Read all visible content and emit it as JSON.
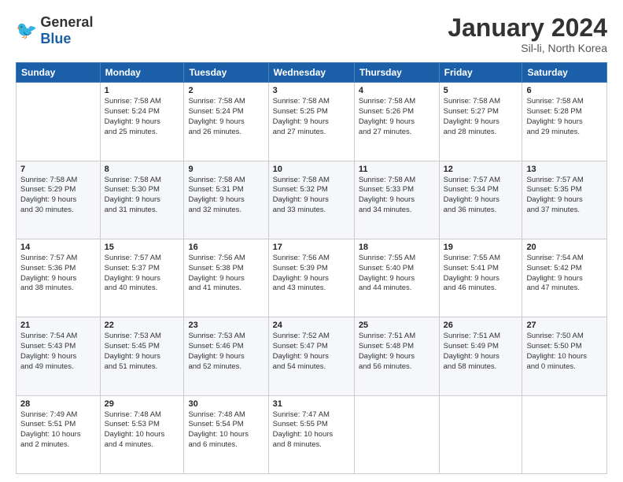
{
  "header": {
    "logo_general": "General",
    "logo_blue": "Blue",
    "month": "January 2024",
    "location": "Sil-li, North Korea"
  },
  "weekdays": [
    "Sunday",
    "Monday",
    "Tuesday",
    "Wednesday",
    "Thursday",
    "Friday",
    "Saturday"
  ],
  "weeks": [
    [
      {
        "day": "",
        "info": ""
      },
      {
        "day": "1",
        "info": "Sunrise: 7:58 AM\nSunset: 5:24 PM\nDaylight: 9 hours\nand 25 minutes."
      },
      {
        "day": "2",
        "info": "Sunrise: 7:58 AM\nSunset: 5:24 PM\nDaylight: 9 hours\nand 26 minutes."
      },
      {
        "day": "3",
        "info": "Sunrise: 7:58 AM\nSunset: 5:25 PM\nDaylight: 9 hours\nand 27 minutes."
      },
      {
        "day": "4",
        "info": "Sunrise: 7:58 AM\nSunset: 5:26 PM\nDaylight: 9 hours\nand 27 minutes."
      },
      {
        "day": "5",
        "info": "Sunrise: 7:58 AM\nSunset: 5:27 PM\nDaylight: 9 hours\nand 28 minutes."
      },
      {
        "day": "6",
        "info": "Sunrise: 7:58 AM\nSunset: 5:28 PM\nDaylight: 9 hours\nand 29 minutes."
      }
    ],
    [
      {
        "day": "7",
        "info": "Sunrise: 7:58 AM\nSunset: 5:29 PM\nDaylight: 9 hours\nand 30 minutes."
      },
      {
        "day": "8",
        "info": "Sunrise: 7:58 AM\nSunset: 5:30 PM\nDaylight: 9 hours\nand 31 minutes."
      },
      {
        "day": "9",
        "info": "Sunrise: 7:58 AM\nSunset: 5:31 PM\nDaylight: 9 hours\nand 32 minutes."
      },
      {
        "day": "10",
        "info": "Sunrise: 7:58 AM\nSunset: 5:32 PM\nDaylight: 9 hours\nand 33 minutes."
      },
      {
        "day": "11",
        "info": "Sunrise: 7:58 AM\nSunset: 5:33 PM\nDaylight: 9 hours\nand 34 minutes."
      },
      {
        "day": "12",
        "info": "Sunrise: 7:57 AM\nSunset: 5:34 PM\nDaylight: 9 hours\nand 36 minutes."
      },
      {
        "day": "13",
        "info": "Sunrise: 7:57 AM\nSunset: 5:35 PM\nDaylight: 9 hours\nand 37 minutes."
      }
    ],
    [
      {
        "day": "14",
        "info": "Sunrise: 7:57 AM\nSunset: 5:36 PM\nDaylight: 9 hours\nand 38 minutes."
      },
      {
        "day": "15",
        "info": "Sunrise: 7:57 AM\nSunset: 5:37 PM\nDaylight: 9 hours\nand 40 minutes."
      },
      {
        "day": "16",
        "info": "Sunrise: 7:56 AM\nSunset: 5:38 PM\nDaylight: 9 hours\nand 41 minutes."
      },
      {
        "day": "17",
        "info": "Sunrise: 7:56 AM\nSunset: 5:39 PM\nDaylight: 9 hours\nand 43 minutes."
      },
      {
        "day": "18",
        "info": "Sunrise: 7:55 AM\nSunset: 5:40 PM\nDaylight: 9 hours\nand 44 minutes."
      },
      {
        "day": "19",
        "info": "Sunrise: 7:55 AM\nSunset: 5:41 PM\nDaylight: 9 hours\nand 46 minutes."
      },
      {
        "day": "20",
        "info": "Sunrise: 7:54 AM\nSunset: 5:42 PM\nDaylight: 9 hours\nand 47 minutes."
      }
    ],
    [
      {
        "day": "21",
        "info": "Sunrise: 7:54 AM\nSunset: 5:43 PM\nDaylight: 9 hours\nand 49 minutes."
      },
      {
        "day": "22",
        "info": "Sunrise: 7:53 AM\nSunset: 5:45 PM\nDaylight: 9 hours\nand 51 minutes."
      },
      {
        "day": "23",
        "info": "Sunrise: 7:53 AM\nSunset: 5:46 PM\nDaylight: 9 hours\nand 52 minutes."
      },
      {
        "day": "24",
        "info": "Sunrise: 7:52 AM\nSunset: 5:47 PM\nDaylight: 9 hours\nand 54 minutes."
      },
      {
        "day": "25",
        "info": "Sunrise: 7:51 AM\nSunset: 5:48 PM\nDaylight: 9 hours\nand 56 minutes."
      },
      {
        "day": "26",
        "info": "Sunrise: 7:51 AM\nSunset: 5:49 PM\nDaylight: 9 hours\nand 58 minutes."
      },
      {
        "day": "27",
        "info": "Sunrise: 7:50 AM\nSunset: 5:50 PM\nDaylight: 10 hours\nand 0 minutes."
      }
    ],
    [
      {
        "day": "28",
        "info": "Sunrise: 7:49 AM\nSunset: 5:51 PM\nDaylight: 10 hours\nand 2 minutes."
      },
      {
        "day": "29",
        "info": "Sunrise: 7:48 AM\nSunset: 5:53 PM\nDaylight: 10 hours\nand 4 minutes."
      },
      {
        "day": "30",
        "info": "Sunrise: 7:48 AM\nSunset: 5:54 PM\nDaylight: 10 hours\nand 6 minutes."
      },
      {
        "day": "31",
        "info": "Sunrise: 7:47 AM\nSunset: 5:55 PM\nDaylight: 10 hours\nand 8 minutes."
      },
      {
        "day": "",
        "info": ""
      },
      {
        "day": "",
        "info": ""
      },
      {
        "day": "",
        "info": ""
      }
    ]
  ]
}
